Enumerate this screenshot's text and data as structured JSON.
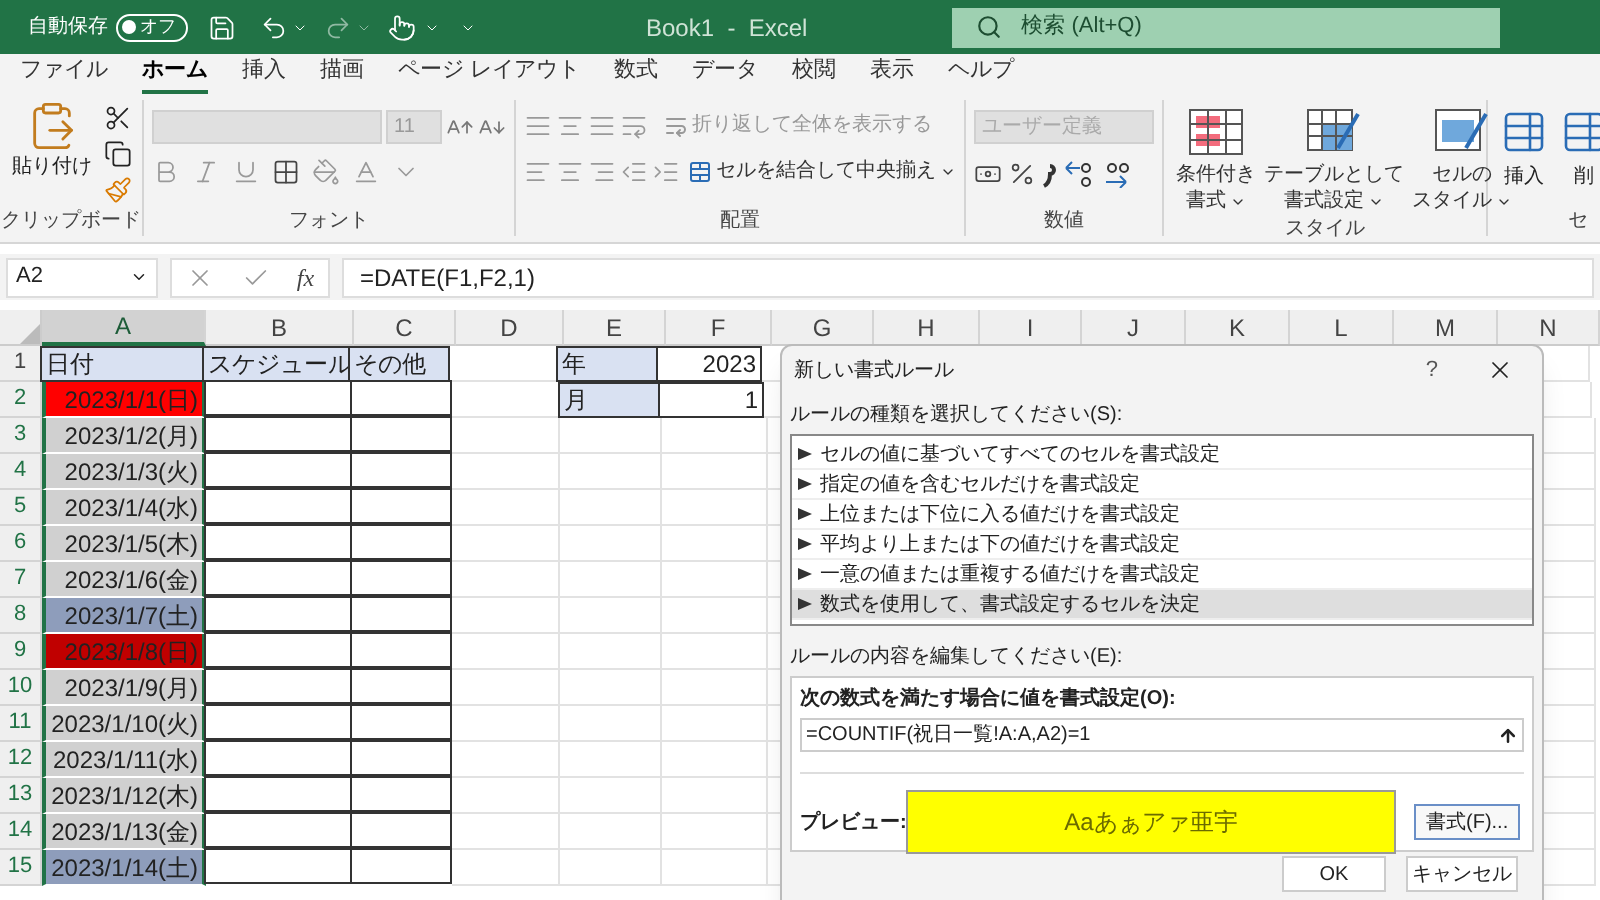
{
  "title_bar": {
    "autosave_label": "自動保存",
    "autosave_toggle": {
      "label": "オフ",
      "on": false
    },
    "document_title": "Book1  -  Excel",
    "search": {
      "placeholder": "検索 (Alt+Q)"
    }
  },
  "ribbon_tabs": [
    {
      "label": "ファイル",
      "selected": false
    },
    {
      "label": "ホーム",
      "selected": true
    },
    {
      "label": "挿入",
      "selected": false
    },
    {
      "label": "描画",
      "selected": false
    },
    {
      "label": "ページ レイアウト",
      "selected": false
    },
    {
      "label": "数式",
      "selected": false
    },
    {
      "label": "データ",
      "selected": false
    },
    {
      "label": "校閲",
      "selected": false
    },
    {
      "label": "表示",
      "selected": false
    },
    {
      "label": "ヘルプ",
      "selected": false
    }
  ],
  "ribbon": {
    "clipboard": {
      "paste": "貼り付け",
      "label": "クリップボード"
    },
    "font": {
      "font_size": "11",
      "label": "フォント"
    },
    "alignment": {
      "wrap_text": "折り返して全体を表示する",
      "merge_center": "セルを結合して中央揃え",
      "label": "配置"
    },
    "number": {
      "format": "ユーザー定義",
      "label": "数値"
    },
    "styles": {
      "buttons": [
        {
          "lines": [
            "条件付き",
            "書式"
          ],
          "kind": "conditional"
        },
        {
          "lines": [
            "テーブルとして",
            "書式設定"
          ],
          "kind": "table"
        },
        {
          "lines": [
            "セルの",
            "スタイル"
          ],
          "kind": "cellstyle"
        }
      ],
      "label": "スタイル"
    },
    "cells": {
      "insert": "挿入",
      "delete": "削",
      "label": "セ"
    }
  },
  "formula_bar": {
    "name_box": "A2",
    "function_label": "fx",
    "formula": "=DATE(F1,F2,1)"
  },
  "sheet": {
    "columns": [
      {
        "label": "A",
        "selected": true
      },
      {
        "label": "B",
        "selected": false
      },
      {
        "label": "C",
        "selected": false
      },
      {
        "label": "D",
        "selected": false
      },
      {
        "label": "E",
        "selected": false
      },
      {
        "label": "F",
        "selected": false
      },
      {
        "label": "G",
        "selected": false
      },
      {
        "label": "H",
        "selected": false
      },
      {
        "label": "I",
        "selected": false
      },
      {
        "label": "J",
        "selected": false
      },
      {
        "label": "K",
        "selected": false
      },
      {
        "label": "L",
        "selected": false
      },
      {
        "label": "M",
        "selected": false
      },
      {
        "label": "N",
        "selected": false
      }
    ],
    "rows": [
      {
        "number": "1",
        "cells": [
          {
            "kind": "header",
            "text": "日付"
          },
          {
            "kind": "header",
            "text": "スケジュール"
          },
          {
            "kind": "header",
            "text": "その他"
          },
          {
            "kind": "empty"
          },
          {
            "kind": "header",
            "text": "年"
          },
          {
            "kind": "value",
            "text": "2023"
          }
        ]
      },
      {
        "number": "2",
        "cells": [
          {
            "kind": "date",
            "text": "2023/1/1(日)",
            "color": "#ff0000"
          },
          {
            "kind": "blank"
          },
          {
            "kind": "blank"
          },
          {
            "kind": "empty"
          },
          {
            "kind": "header",
            "text": "月"
          },
          {
            "kind": "value",
            "text": "1"
          }
        ]
      },
      {
        "number": "3",
        "cells": [
          {
            "kind": "date",
            "text": "2023/1/2(月)",
            "color": "#d0d0d0"
          },
          {
            "kind": "blank"
          },
          {
            "kind": "blank"
          }
        ]
      },
      {
        "number": "4",
        "cells": [
          {
            "kind": "date",
            "text": "2023/1/3(火)",
            "color": "#d0d0d0"
          },
          {
            "kind": "blank"
          },
          {
            "kind": "blank"
          }
        ]
      },
      {
        "number": "5",
        "cells": [
          {
            "kind": "date",
            "text": "2023/1/4(水)",
            "color": "#d0d0d0"
          },
          {
            "kind": "blank"
          },
          {
            "kind": "blank"
          }
        ]
      },
      {
        "number": "6",
        "cells": [
          {
            "kind": "date",
            "text": "2023/1/5(木)",
            "color": "#d0d0d0"
          },
          {
            "kind": "blank"
          },
          {
            "kind": "blank"
          }
        ]
      },
      {
        "number": "7",
        "cells": [
          {
            "kind": "date",
            "text": "2023/1/6(金)",
            "color": "#d0d0d0"
          },
          {
            "kind": "blank"
          },
          {
            "kind": "blank"
          }
        ]
      },
      {
        "number": "8",
        "cells": [
          {
            "kind": "date",
            "text": "2023/1/7(土)",
            "color": "#8e9dbb"
          },
          {
            "kind": "blank"
          },
          {
            "kind": "blank"
          }
        ]
      },
      {
        "number": "9",
        "cells": [
          {
            "kind": "date",
            "text": "2023/1/8(日)",
            "color": "#c00000"
          },
          {
            "kind": "blank"
          },
          {
            "kind": "blank"
          }
        ]
      },
      {
        "number": "10",
        "cells": [
          {
            "kind": "date",
            "text": "2023/1/9(月)",
            "color": "#d0d0d0"
          },
          {
            "kind": "blank"
          },
          {
            "kind": "blank"
          }
        ]
      },
      {
        "number": "11",
        "cells": [
          {
            "kind": "date",
            "text": "2023/1/10(火)",
            "color": "#d0d0d0"
          },
          {
            "kind": "blank"
          },
          {
            "kind": "blank"
          }
        ]
      },
      {
        "number": "12",
        "cells": [
          {
            "kind": "date",
            "text": "2023/1/11(水)",
            "color": "#d0d0d0"
          },
          {
            "kind": "blank"
          },
          {
            "kind": "blank"
          }
        ]
      },
      {
        "number": "13",
        "cells": [
          {
            "kind": "date",
            "text": "2023/1/12(木)",
            "color": "#d0d0d0"
          },
          {
            "kind": "blank"
          },
          {
            "kind": "blank"
          }
        ]
      },
      {
        "number": "14",
        "cells": [
          {
            "kind": "date",
            "text": "2023/1/13(金)",
            "color": "#d0d0d0"
          },
          {
            "kind": "blank"
          },
          {
            "kind": "blank"
          }
        ]
      },
      {
        "number": "15",
        "cells": [
          {
            "kind": "date",
            "text": "2023/1/14(土)",
            "color": "#8e9dbb"
          },
          {
            "kind": "blank"
          },
          {
            "kind": "blank"
          }
        ]
      }
    ]
  },
  "dialog": {
    "title": "新しい書式ルール",
    "help": "?",
    "rule_type_label": "ルールの種類を選択してください(S):",
    "rule_types": [
      {
        "label": "セルの値に基づいてすべてのセルを書式設定",
        "selected": false
      },
      {
        "label": "指定の値を含むセルだけを書式設定",
        "selected": false
      },
      {
        "label": "上位または下位に入る値だけを書式設定",
        "selected": false
      },
      {
        "label": "平均より上または下の値だけを書式設定",
        "selected": false
      },
      {
        "label": "一意の値または重複する値だけを書式設定",
        "selected": false
      },
      {
        "label": "数式を使用して、書式設定するセルを決定",
        "selected": true
      }
    ],
    "edit_label": "ルールの内容を編集してください(E):",
    "formula_label": "次の数式を満たす場合に値を書式設定(O):",
    "formula": "=COUNTIF(祝日一覧!A:A,A2)=1",
    "preview_label": "プレビュー:",
    "preview_text": "Aaあぁアァ亜宇",
    "format_button": "書式(F)...",
    "ok_button": "OK",
    "cancel_button": "キャンセル"
  }
}
